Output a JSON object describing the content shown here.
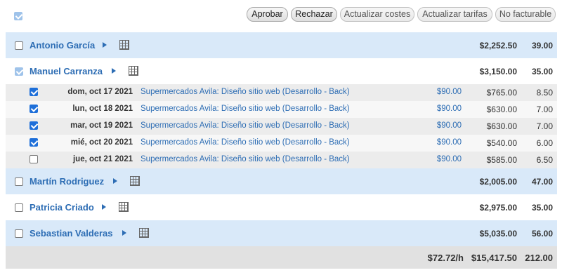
{
  "toolbar": {
    "buttons": [
      {
        "label": "Aprobar",
        "enabled": true
      },
      {
        "label": "Rechazar",
        "enabled": true
      },
      {
        "label": "Actualizar costes",
        "enabled": false
      },
      {
        "label": "Actualizar tarifas",
        "enabled": false
      },
      {
        "label": "No facturable",
        "enabled": false
      }
    ]
  },
  "people": [
    {
      "name": "Antonio García",
      "amount": "$2,252.50",
      "hours": "39.00",
      "checked": false
    },
    {
      "name": "Manuel Carranza",
      "amount": "$3,150.00",
      "hours": "35.00",
      "checked": "partial",
      "entries": [
        {
          "date": "dom, oct 17 2021",
          "description": "Supermercados Avila: Diseño sitio web (Desarrollo - Back)",
          "rate": "$90.00",
          "amount": "$765.00",
          "hours": "8.50",
          "checked": true
        },
        {
          "date": "lun, oct 18 2021",
          "description": "Supermercados Avila: Diseño sitio web (Desarrollo - Back)",
          "rate": "$90.00",
          "amount": "$630.00",
          "hours": "7.00",
          "checked": true
        },
        {
          "date": "mar, oct 19 2021",
          "description": "Supermercados Avila: Diseño sitio web (Desarrollo - Back)",
          "rate": "$90.00",
          "amount": "$630.00",
          "hours": "7.00",
          "checked": true
        },
        {
          "date": "mié, oct 20 2021",
          "description": "Supermercados Avila: Diseño sitio web (Desarrollo - Back)",
          "rate": "$90.00",
          "amount": "$540.00",
          "hours": "6.00",
          "checked": true
        },
        {
          "date": "jue, oct 21 2021",
          "description": "Supermercados Avila: Diseño sitio web (Desarrollo - Back)",
          "rate": "$90.00",
          "amount": "$585.00",
          "hours": "6.50",
          "checked": false
        }
      ]
    },
    {
      "name": "Martín Rodriguez",
      "amount": "$2,005.00",
      "hours": "47.00",
      "checked": false
    },
    {
      "name": "Patricia Criado",
      "amount": "$2,975.00",
      "hours": "35.00",
      "checked": false
    },
    {
      "name": "Sebastian Valderas",
      "amount": "$5,035.00",
      "hours": "56.00",
      "checked": false
    }
  ],
  "totals": {
    "rate": "$72.72/h",
    "amount": "$15,417.50",
    "hours": "212.00"
  },
  "colors": {
    "link": "#2d6db4",
    "row_blue": "#d9e9f9",
    "row_grey": "#ececec",
    "total_bg": "#e1e1e1",
    "checkbox_checked": "#1e6fd9"
  }
}
